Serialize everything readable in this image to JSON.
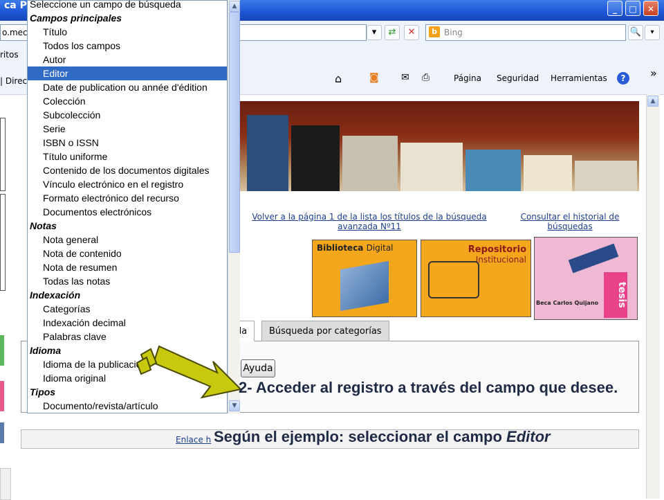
{
  "window": {
    "title": "ca PM",
    "minimize": "_",
    "maximize": "□",
    "close": "✕"
  },
  "address": {
    "url": "o.mec.g",
    "search_placeholder": "Bing"
  },
  "favorites": {
    "label": "ritos"
  },
  "links_bar": {
    "label": "| Direc"
  },
  "command_bar": {
    "pagina": "Página",
    "seguridad": "Seguridad",
    "herramientas": "Herramientas",
    "more": "»"
  },
  "dropdown": {
    "options": [
      {
        "label": "Seleccione un campo de búsqueda",
        "kind": "item0"
      },
      {
        "label": "Campos principales",
        "kind": "hdr"
      },
      {
        "label": "Título",
        "kind": "item"
      },
      {
        "label": "Todos los campos",
        "kind": "item"
      },
      {
        "label": "Autor",
        "kind": "item"
      },
      {
        "label": "Editor",
        "kind": "sel"
      },
      {
        "label": "Date de publication ou année d'édition",
        "kind": "item"
      },
      {
        "label": "Colección",
        "kind": "item"
      },
      {
        "label": "Subcolección",
        "kind": "item"
      },
      {
        "label": "Serie",
        "kind": "item"
      },
      {
        "label": "ISBN o ISSN",
        "kind": "item"
      },
      {
        "label": "Título uniforme",
        "kind": "item"
      },
      {
        "label": "Contenido de los documentos digitales",
        "kind": "item"
      },
      {
        "label": "Vínculo electrónico en el registro",
        "kind": "item"
      },
      {
        "label": "Formato electrónico del recurso",
        "kind": "item"
      },
      {
        "label": "Documentos electrónicos",
        "kind": "item"
      },
      {
        "label": "Notas",
        "kind": "hdr"
      },
      {
        "label": "Nota general",
        "kind": "item"
      },
      {
        "label": "Nota de contenido",
        "kind": "item"
      },
      {
        "label": "Nota de resumen",
        "kind": "item"
      },
      {
        "label": "Todas las notas",
        "kind": "item"
      },
      {
        "label": "Indexación",
        "kind": "hdr"
      },
      {
        "label": "Categorías",
        "kind": "item"
      },
      {
        "label": "Indexación decimal",
        "kind": "item"
      },
      {
        "label": "Palabras clave",
        "kind": "item"
      },
      {
        "label": "Idioma",
        "kind": "hdr"
      },
      {
        "label": "Idioma de la publicación",
        "kind": "item"
      },
      {
        "label": "Idioma original",
        "kind": "item"
      },
      {
        "label": "Tipos",
        "kind": "hdr"
      },
      {
        "label": "Documento/revista/artículo",
        "kind": "item"
      }
    ]
  },
  "page": {
    "link_volver": "Volver a la página 1 de la lista los títulos de la búsqueda avanzada Nº11",
    "link_historial": "Consultar el historial de búsquedas",
    "tile1": {
      "title": "Biblioteca",
      "subtitle": "Digital"
    },
    "tile2": {
      "title": "Repositorio",
      "subtitle": "Institucional"
    },
    "tile3": {
      "caption": "Beca Carlos Quijano",
      "word": "tesis"
    },
    "tab_partial": "da",
    "tab_categorias": "Búsqueda por categorías",
    "ayuda": "Ayuda",
    "enlace": "Enlace h"
  },
  "annotations": {
    "step": "2- Acceder al registro a través del campo que desee.",
    "example_prefix": "Según el ejemplo: seleccionar el campo ",
    "example_field": "Editor"
  },
  "colors": {
    "selection": "#316ac5",
    "arrow_fill": "#c8c80e",
    "tile_orange": "#f4a61d",
    "tile_pink": "#efb9d3"
  }
}
